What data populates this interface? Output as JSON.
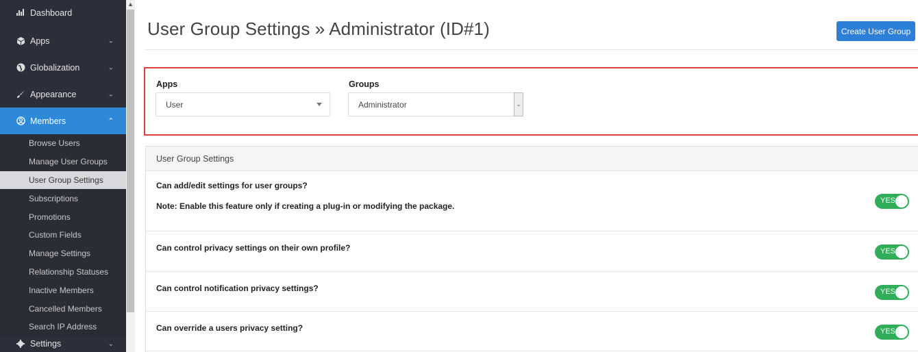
{
  "sidebar": {
    "items": [
      {
        "label": "Dashboard",
        "icon": "chart-icon"
      },
      {
        "label": "Apps",
        "icon": "cubes-icon"
      },
      {
        "label": "Globalization",
        "icon": "globe-icon"
      },
      {
        "label": "Appearance",
        "icon": "brush-icon"
      },
      {
        "label": "Members",
        "icon": "user-circle-icon"
      }
    ],
    "submenu": [
      "Browse Users",
      "Manage User Groups",
      "User Group Settings",
      "Subscriptions",
      "Promotions",
      "Custom Fields",
      "Manage Settings",
      "Relationship Statuses",
      "Inactive Members",
      "Cancelled Members",
      "Search IP Address"
    ],
    "bottom": {
      "label": "Settings",
      "icon": "gear-icon"
    }
  },
  "header": {
    "title": "User Group Settings » Administrator (ID#1)",
    "create_button": "Create User Group"
  },
  "filters": {
    "apps_label": "Apps",
    "apps_value": "User",
    "groups_label": "Groups",
    "groups_value": "Administrator"
  },
  "panel": {
    "title": "User Group Settings",
    "settings": [
      {
        "question": "Can add/edit settings for user groups?",
        "note": "Note: Enable this feature only if creating a plug-in or modifying the package.",
        "toggle": "YES"
      },
      {
        "question": "Can control privacy settings on their own profile?",
        "toggle": "YES"
      },
      {
        "question": "Can control notification privacy settings?",
        "toggle": "YES"
      },
      {
        "question": "Can override a users privacy setting?",
        "toggle": "YES"
      }
    ]
  },
  "colors": {
    "accent": "#2e8ad8",
    "toggle_on": "#2fad58",
    "highlight_border": "#d9413f"
  }
}
